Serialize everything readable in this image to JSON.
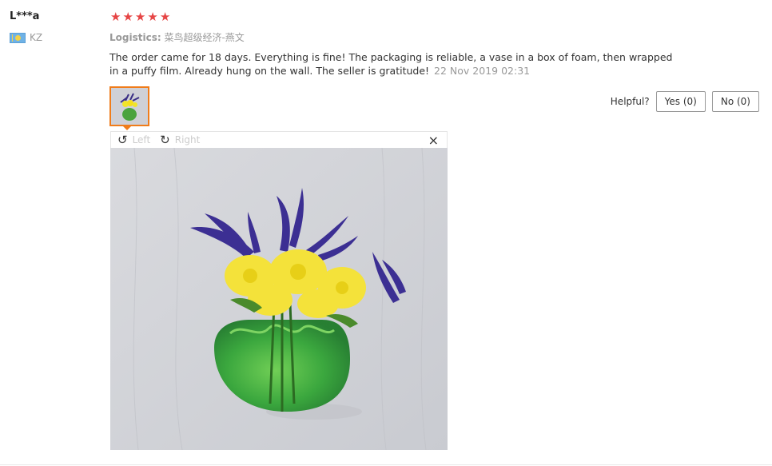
{
  "review": {
    "user_name": "L***a",
    "country_code": "KZ",
    "rating": 5,
    "logistics_label": "Logistics:",
    "logistics_value": "菜鸟超级经济-燕文",
    "text": "The order came for 18 days. Everything is fine! The packaging is reliable, a vase in a box of foam, then wrapped in a puffy film. Already hung on the wall. The seller is gratitude!",
    "date": "22 Nov 2019 02:31"
  },
  "helpful": {
    "label": "Helpful?",
    "yes_label": "Yes (0)",
    "no_label": "No (0)"
  },
  "viewer": {
    "rotate_left_label": "Left",
    "rotate_right_label": "Right",
    "close_symbol": "×"
  },
  "icons": {
    "star": "star-icon",
    "flag": "kz-flag-icon",
    "rotate_left": "rotate-left-icon",
    "rotate_right": "rotate-right-icon",
    "close": "close-icon"
  },
  "colors": {
    "star": "#e64545",
    "thumb_border": "#f07c1a",
    "muted_text": "#999999"
  }
}
